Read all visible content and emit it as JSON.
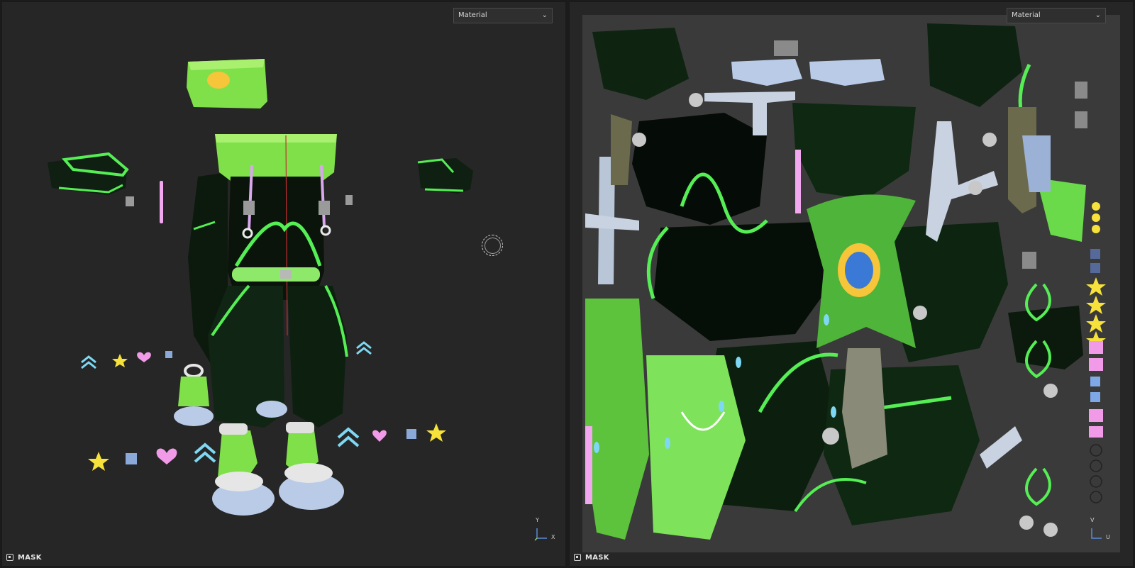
{
  "viewport_3d": {
    "material_dropdown": "Material",
    "mask_label": "MASK",
    "axes": {
      "vertical": "Y",
      "horizontal": "X"
    }
  },
  "viewport_uv": {
    "material_dropdown": "Material",
    "mask_label": "MASK",
    "axes": {
      "vertical": "V",
      "horizontal": "U"
    }
  },
  "icons": {
    "dropdown": "chevron-down-icon",
    "mask": "mask-checkbox-icon",
    "brush": "brush-cursor-icon",
    "gizmo": "axis-gizmo-icon"
  },
  "colors": {
    "background": "#262626",
    "uv_canvas": "#3a3a3a",
    "neon_green": "#55ee55",
    "lime": "#7fe04a",
    "dark_fabric": "#0e1a10",
    "shoe_blue": "#b9cbe6",
    "star_yellow": "#f6e23a",
    "heart_pink": "#f19be8",
    "arrow_cyan": "#7fd8f3"
  }
}
